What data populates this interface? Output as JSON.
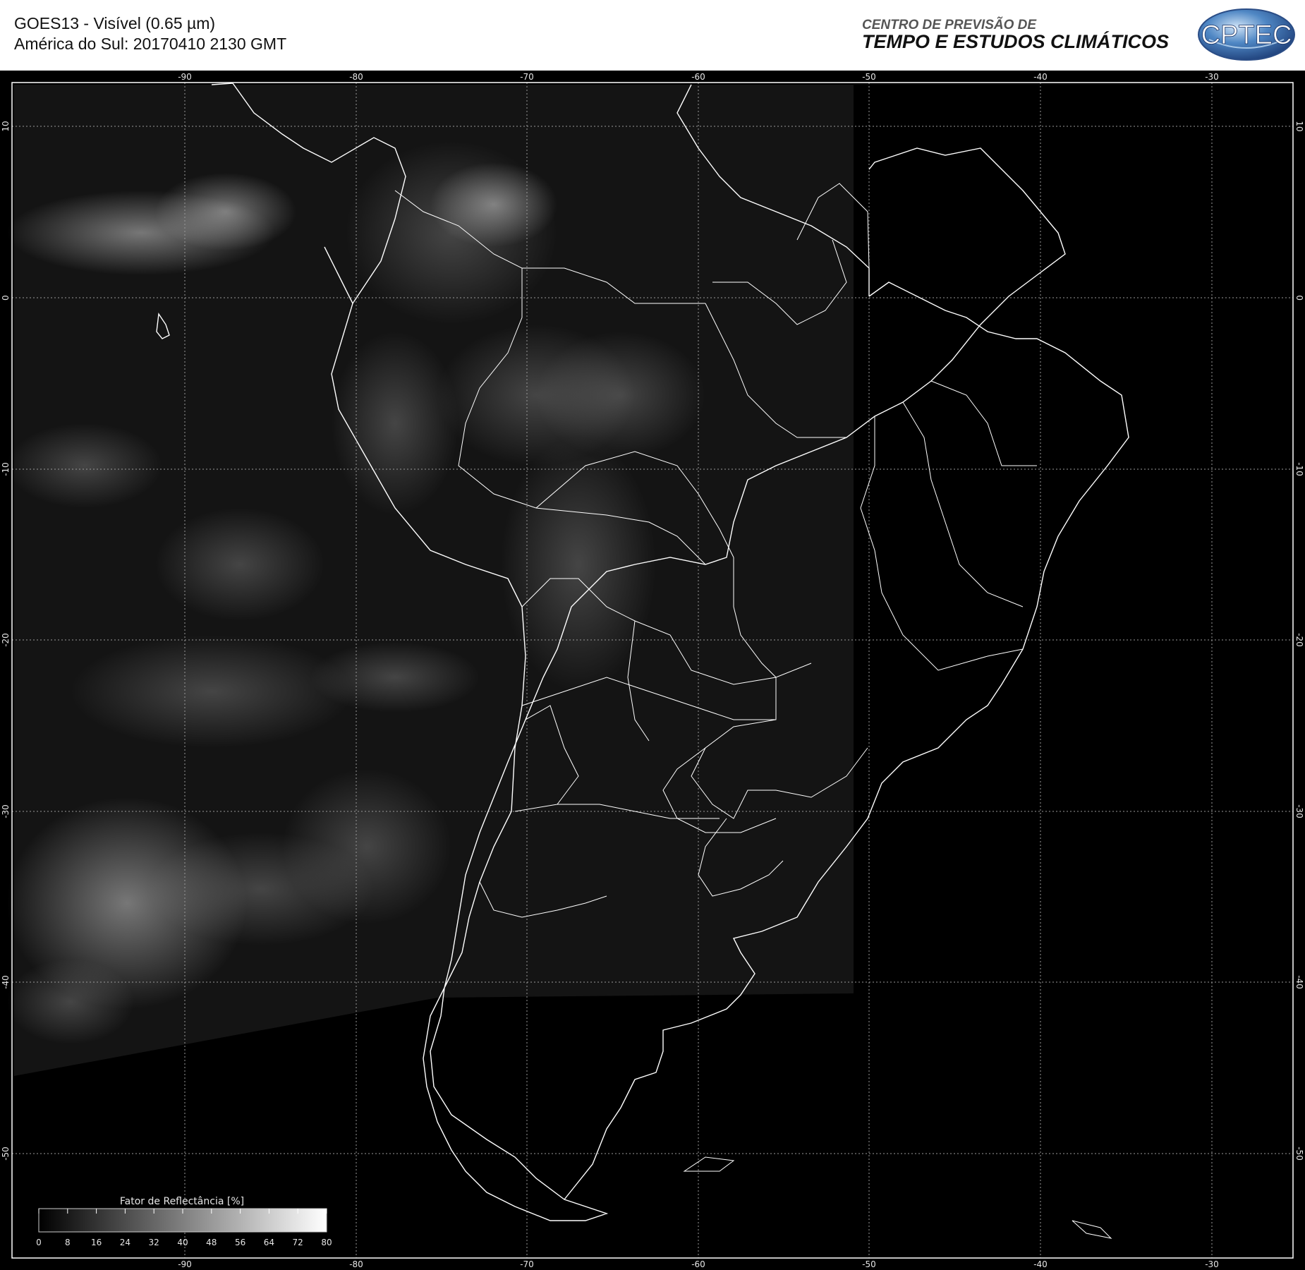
{
  "header": {
    "title_line1": "GOES13 - Visível (0.65 µm)",
    "title_line2": "América do Sul: 20170410 2130 GMT",
    "org_line1": "CENTRO DE PREVISÃO DE",
    "org_line2": "TEMPO E ESTUDOS CLIMÁTICOS",
    "logo_text": "CPTEC"
  },
  "map": {
    "longitude_labels": [
      "-90",
      "-80",
      "-70",
      "-60",
      "-50",
      "-40",
      "-30"
    ],
    "latitude_labels": [
      "10",
      "0",
      "-10",
      "-20",
      "-30",
      "-40",
      "-50"
    ],
    "grid": true,
    "colors": {
      "background": "#000000",
      "coastline": "#ffffff",
      "grid": "#9a9a9a",
      "cloud": "#bdbdbd"
    }
  },
  "colorbar": {
    "title": "Fator de Reflectância [%]",
    "labels": [
      "0",
      "8",
      "16",
      "24",
      "32",
      "40",
      "48",
      "56",
      "64",
      "72",
      "80"
    ],
    "min": 0,
    "max": 80
  }
}
